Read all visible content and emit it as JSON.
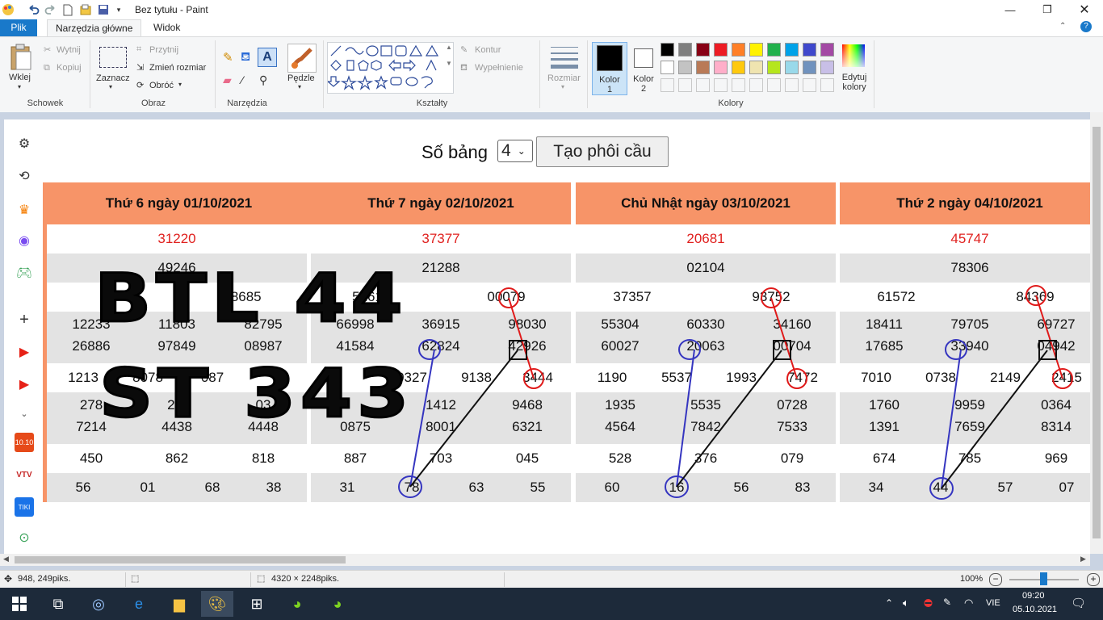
{
  "window": {
    "title": "Bez tytułu - Paint",
    "quick_access": [
      "undo-icon",
      "redo-icon",
      "new-icon",
      "open-icon",
      "save-icon",
      "customize-icon"
    ]
  },
  "menu": {
    "tabs": [
      "Plik",
      "Narzędzia główne",
      "Widok"
    ],
    "active": "Narzędzia główne",
    "file_color": "#1979ca"
  },
  "ribbon": {
    "clipboard": {
      "label": "Schowek",
      "paste": "Wklej",
      "cut": "Wytnij",
      "copy": "Kopiuj"
    },
    "image": {
      "label": "Obraz",
      "select": "Zaznacz",
      "crop": "Przytnij",
      "resize": "Zmień rozmiar",
      "rotate": "Obróć"
    },
    "tools": {
      "label": "Narzędzia"
    },
    "brushes": {
      "label": "Pędzle"
    },
    "shapes": {
      "label": "Kształty",
      "outline": "Kontur",
      "fill": "Wypełnienie"
    },
    "size": {
      "label": "Rozmiar"
    },
    "color1": {
      "label": "Kolor 1",
      "value": "#000000"
    },
    "color2": {
      "label": "Kolor 2",
      "value": "#ffffff"
    },
    "colors": {
      "label": "Kolory",
      "edit": "Edytuj kolory",
      "palette_row1": [
        "#000000",
        "#7f7f7f",
        "#880015",
        "#ed1c24",
        "#ff7f27",
        "#fff200",
        "#22b14c",
        "#00a2e8",
        "#3f48cc",
        "#a349a4"
      ],
      "palette_row2": [
        "#ffffff",
        "#c3c3c3",
        "#b97a57",
        "#ffaec9",
        "#ffc90e",
        "#efe4b0",
        "#b5e61d",
        "#99d9ea",
        "#7092be",
        "#c8bfe7"
      ]
    }
  },
  "page": {
    "label": "Số bảng",
    "select_value": "4",
    "button": "Tạo phôi cầu"
  },
  "overlay_text": {
    "line1": "BTL 44",
    "line2": "ST 343"
  },
  "days": [
    {
      "date": "Thứ 6 ngày 01/10/2021",
      "special": "31220",
      "g1": "49246",
      "g2": [
        "2",
        "28685"
      ],
      "g3a": [
        "12233",
        "11803",
        "82795"
      ],
      "g3b": [
        "26886",
        "97849",
        "08987"
      ],
      "g4": [
        "1213",
        "8078",
        "087"
      ],
      "g5a": [
        "278",
        "2 5",
        "03"
      ],
      "g5b": [
        "7214",
        "4438",
        "4448"
      ],
      "g6": [
        "450",
        "862",
        "818"
      ],
      "g7": [
        "56",
        "01",
        "68",
        "38"
      ]
    },
    {
      "date": "Thứ 7 ngày 02/10/2021",
      "special": "37377",
      "g1": "21288",
      "g2": [
        "5261",
        "00079"
      ],
      "g3a": [
        "66998",
        "36915",
        "98030"
      ],
      "g3b": [
        "41584",
        "62824",
        "42926"
      ],
      "g4": [
        "",
        "0327",
        "9138",
        "3444"
      ],
      "g5a": [
        "",
        "1412",
        "9468"
      ],
      "g5b": [
        "0875",
        "8001",
        "6321"
      ],
      "g6": [
        "887",
        "703",
        "045"
      ],
      "g7": [
        "31",
        "78",
        "63",
        "55"
      ]
    },
    {
      "date": "Chủ Nhật ngày 03/10/2021",
      "special": "20681",
      "g1": "02104",
      "g2": [
        "37357",
        "93752"
      ],
      "g3a": [
        "55304",
        "60330",
        "34160"
      ],
      "g3b": [
        "60027",
        "20063",
        "00704"
      ],
      "g4": [
        "1190",
        "5537",
        "1993",
        "7472"
      ],
      "g5a": [
        "1935",
        "5535",
        "0728"
      ],
      "g5b": [
        "4564",
        "7842",
        "7533"
      ],
      "g6": [
        "528",
        "376",
        "079"
      ],
      "g7": [
        "60",
        "16",
        "56",
        "83"
      ]
    },
    {
      "date": "Thứ 2 ngày 04/10/2021",
      "special": "45747",
      "g1": "78306",
      "g2": [
        "61572",
        "84369"
      ],
      "g3a": [
        "18411",
        "79705",
        "69727"
      ],
      "g3b": [
        "17685",
        "33940",
        "04942"
      ],
      "g4": [
        "7010",
        "0738",
        "2149",
        "2415"
      ],
      "g5a": [
        "1760",
        "9959",
        "0364"
      ],
      "g5b": [
        "1391",
        "7659",
        "8314"
      ],
      "g6": [
        "674",
        "785",
        "969"
      ],
      "g7": [
        "34",
        "44",
        "57",
        "07"
      ]
    }
  ],
  "status": {
    "cursor": "948, 249piks.",
    "size": "4320 × 2248piks.",
    "zoom": "100%"
  },
  "taskbar": {
    "time": "09:20",
    "date": "05.10.2021",
    "lang": "VIE"
  },
  "colors": {
    "header": "#f79468",
    "special_text": "#e0201e",
    "accent_left": "#f79468"
  }
}
